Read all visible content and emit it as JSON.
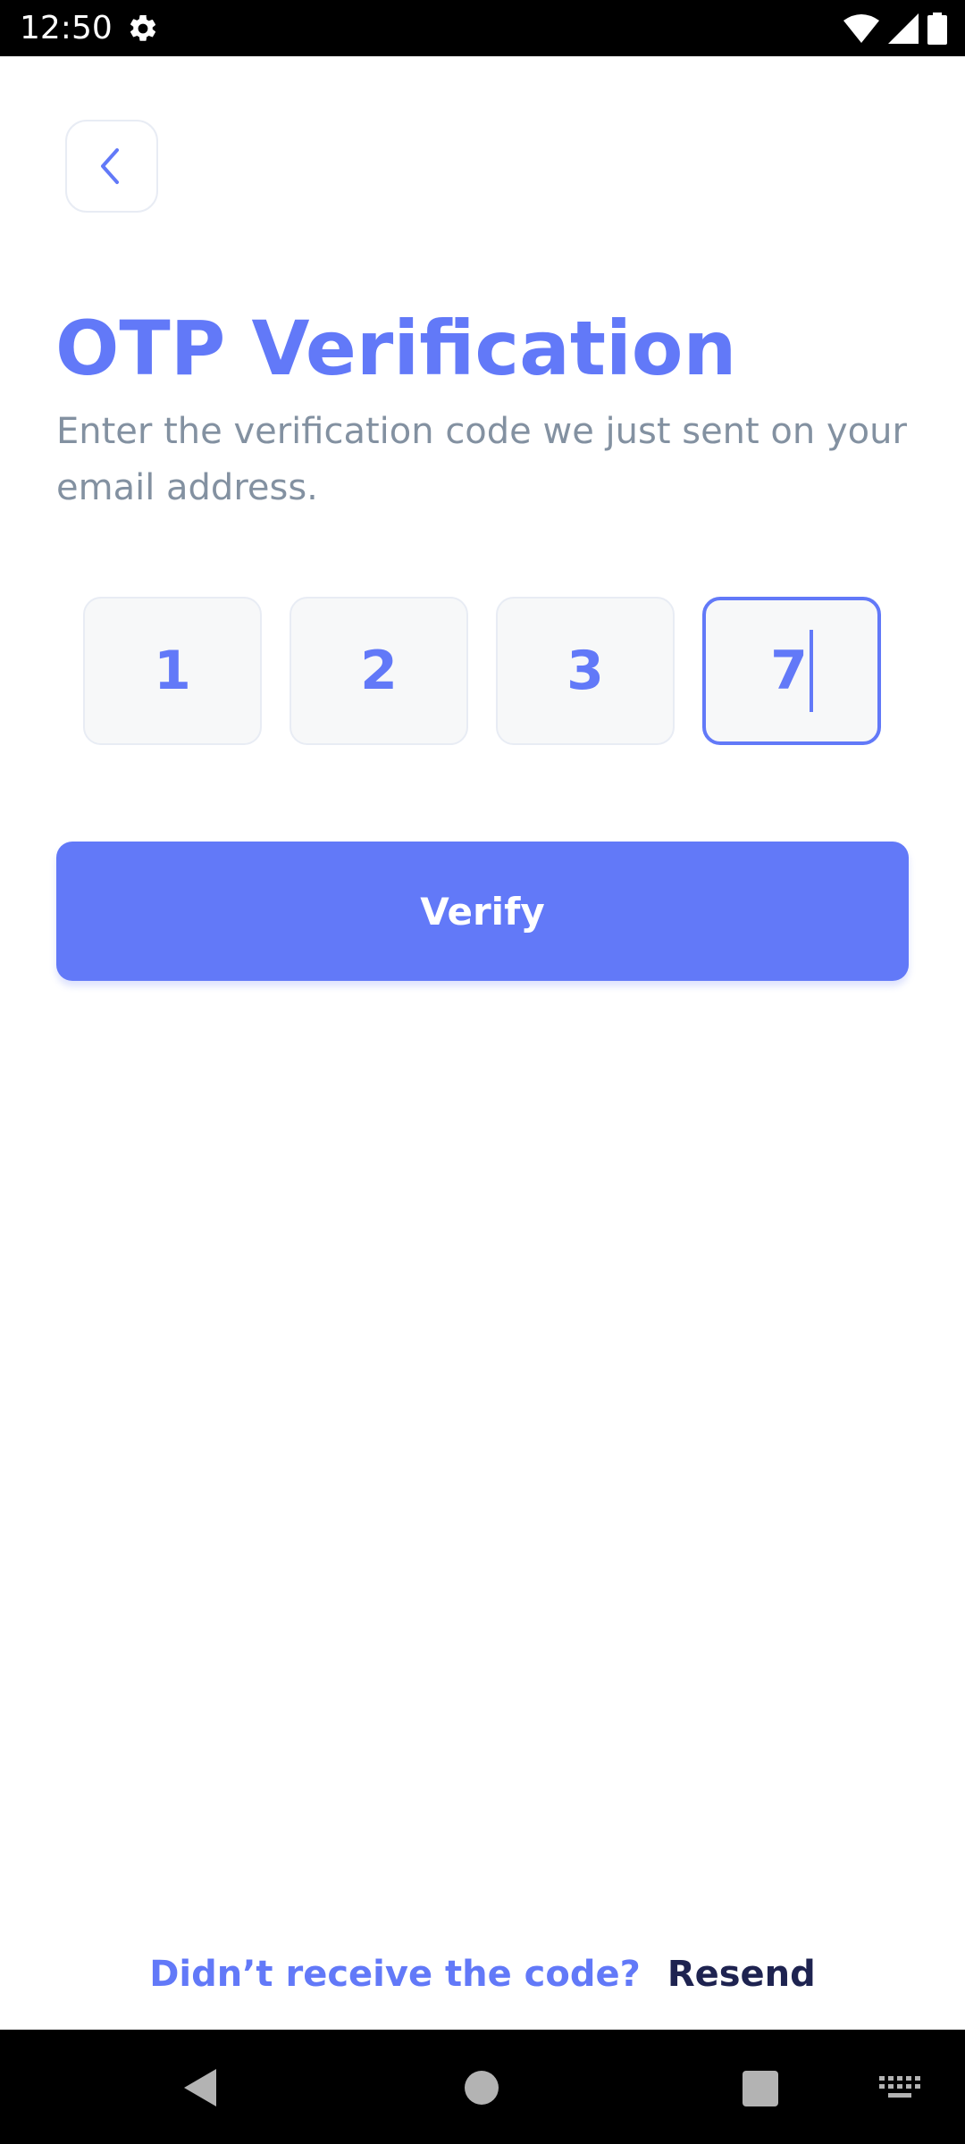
{
  "status_bar": {
    "time": "12:50",
    "icons": [
      "settings-icon",
      "wifi-icon",
      "signal-icon",
      "battery-icon"
    ]
  },
  "header": {
    "back_icon": "chevron-left-icon"
  },
  "title": "OTP Verification",
  "subtitle": "Enter the verification code we just sent on your email address.",
  "otp": {
    "digits": [
      "1",
      "2",
      "3",
      "7"
    ],
    "active_index": 3
  },
  "verify_button": {
    "label": "Verify"
  },
  "resend": {
    "question": "Didn’t receive the code?",
    "link": "Resend"
  },
  "nav_bar": {
    "icons": [
      "back-triangle-icon",
      "home-circle-icon",
      "recents-square-icon",
      "keyboard-icon"
    ]
  },
  "colors": {
    "accent": "#6279f8",
    "subtitle": "#8391a1",
    "field_bg": "#f7f8f9",
    "field_border": "#e8ecf4",
    "resend_link": "#1e2350"
  }
}
